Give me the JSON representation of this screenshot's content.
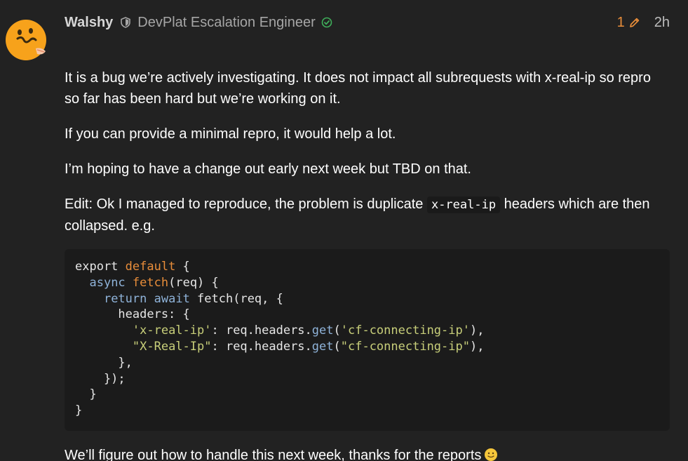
{
  "post": {
    "author": {
      "username": "Walshy",
      "title": "DevPlat Escalation Engineer",
      "avatar_icon": "duck-emoji-avatar"
    },
    "edit_count": "1",
    "age": "2h",
    "paragraphs": [
      "It is a bug we’re actively investigating. It does not impact all subrequests with x-real-ip so repro so far has been hard but we’re working on it.",
      "If you can provide a minimal repro, it would help a lot.",
      "I’m hoping to have a change out early next week but TBD on that."
    ],
    "edit_note": {
      "before": "Edit: Ok I managed to reproduce, the problem is duplicate ",
      "code": "x-real-ip",
      "after": " headers which are then collapsed. e.g."
    },
    "code_block": {
      "lines": [
        [
          [
            "plain",
            "export "
          ],
          [
            "kw",
            "default"
          ],
          [
            "plain",
            " {"
          ]
        ],
        [
          [
            "plain",
            "  "
          ],
          [
            "kw2",
            "async"
          ],
          [
            "plain",
            " "
          ],
          [
            "fn",
            "fetch"
          ],
          [
            "plain",
            "(req) {"
          ]
        ],
        [
          [
            "plain",
            "    "
          ],
          [
            "kw2",
            "return"
          ],
          [
            "plain",
            " "
          ],
          [
            "kw2",
            "await"
          ],
          [
            "plain",
            " fetch(req, {"
          ]
        ],
        [
          [
            "plain",
            "      headers: {"
          ]
        ],
        [
          [
            "plain",
            "        "
          ],
          [
            "str",
            "'x-real-ip'"
          ],
          [
            "plain",
            ": req.headers."
          ],
          [
            "meth",
            "get"
          ],
          [
            "plain",
            "("
          ],
          [
            "str",
            "'cf-connecting-ip'"
          ],
          [
            "plain",
            "),"
          ]
        ],
        [
          [
            "plain",
            "        "
          ],
          [
            "str",
            "\"X-Real-Ip\""
          ],
          [
            "plain",
            ": req.headers."
          ],
          [
            "meth",
            "get"
          ],
          [
            "plain",
            "("
          ],
          [
            "str",
            "\"cf-connecting-ip\""
          ],
          [
            "plain",
            "),"
          ]
        ],
        [
          [
            "plain",
            "      },"
          ]
        ],
        [
          [
            "plain",
            "    });"
          ]
        ],
        [
          [
            "plain",
            "  }"
          ]
        ],
        [
          [
            "plain",
            "}"
          ]
        ]
      ]
    },
    "closing": "We’ll figure out how to handle this next week, thanks for the reports",
    "closing_emoji": "slightly-smiling-face"
  },
  "colors": {
    "background": "#222222",
    "accent": "#e88d3a",
    "verified": "#3fae5a",
    "code_bg": "#1b1b1b"
  }
}
